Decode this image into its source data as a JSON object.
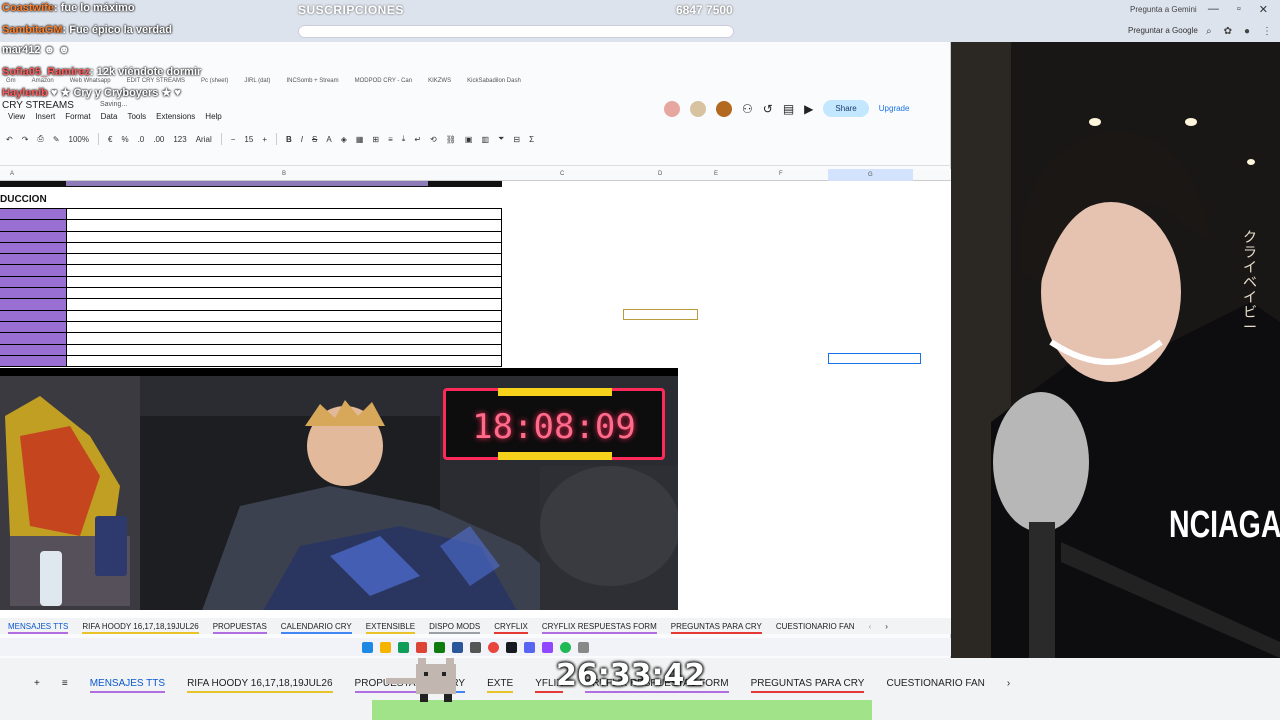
{
  "browser": {
    "tab_title": "SUSCRIPCIONES",
    "counts": "6847  7500",
    "gemini_label": "Pregunta a Gemini",
    "translate_label": "Preguntar a Google"
  },
  "chat": [
    {
      "user": "Coastwife",
      "msg": ": fue lo máximo"
    },
    {
      "user": "SambitaGM",
      "msg": ": Fue épico la verdad"
    },
    {
      "user": "",
      "msg": "mar412"
    },
    {
      "user": "Sofia05_Ramirez",
      "msg": ": 12k viéndote dormir"
    },
    {
      "user": "Haylenib",
      "msg": "Cry y Cryboyers"
    }
  ],
  "sheet": {
    "doc_title": "CRY STREAMS",
    "saving": "Saving...",
    "menus": [
      "View",
      "Insert",
      "Format",
      "Data",
      "Tools",
      "Extensions",
      "Help"
    ],
    "share_label": "Share",
    "upgrade_label": "Upgrade",
    "zoom": "100%",
    "font": "Arial",
    "font_size": "15",
    "currency": "€",
    "percent": "%",
    "dec_minus": ".0",
    "dec_plus": ".00",
    "num_format": "123",
    "columns": [
      "A",
      "B",
      "C",
      "D",
      "E",
      "F",
      "G"
    ],
    "section_label": "DUCCION",
    "bookmarks": [
      "Gm",
      "Amazon",
      "Web Whatsapp",
      "EDIT CRY STREAMS",
      "Pc (sheet)",
      "JIRL (dat)",
      "INCSomb + Stream",
      "MODPOD CRY - Can",
      "KIKZWS",
      "KickSabadilon Dash"
    ]
  },
  "video": {
    "timer": "18:08:09"
  },
  "tabs": [
    {
      "label": "MENSAJES TTS",
      "color": "#b06ee0",
      "active": true
    },
    {
      "label": "RIFA HOODY 16,17,18,19JUL26",
      "color": "#e8c32a",
      "active": false
    },
    {
      "label": "PROPUESTAS",
      "color": "#b06ee0",
      "active": false
    },
    {
      "label": "CALENDARIO CRY",
      "color": "#4285f4",
      "active": false
    },
    {
      "label": "EXTENSIBLE",
      "color": "#e8c32a",
      "active": false
    },
    {
      "label": "DISPO MODS",
      "color": "#9aa0a6",
      "active": false
    },
    {
      "label": "CRYFLIX",
      "color": "#e53935",
      "active": false
    },
    {
      "label": "CRYFLIX RESPUESTAS FORM",
      "color": "#b06ee0",
      "active": false
    },
    {
      "label": "PREGUNTAS PARA CRY",
      "color": "#e53935",
      "active": false
    },
    {
      "label": "CUESTIONARIO FAN",
      "color": "#f1f3f4",
      "active": false
    }
  ],
  "bottom_tabs": [
    {
      "label": "MENSAJES TTS",
      "color": "#b06ee0",
      "active": true
    },
    {
      "label": "RIFA HOODY 16,17,18,19JUL26",
      "color": "#e8c32a",
      "active": false
    },
    {
      "label": "PROPUESTAS",
      "color": "#b06ee0",
      "active": false
    },
    {
      "label": "CRY",
      "color": "#4285f4",
      "active": false
    },
    {
      "label": "EXTE",
      "color": "#e8c32a",
      "active": false
    },
    {
      "label": "YFLIX",
      "color": "#e53935",
      "active": false
    },
    {
      "label": "CRYFLIX RESPUESTAS FORM",
      "color": "#b06ee0",
      "active": false
    },
    {
      "label": "PREGUNTAS PARA CRY",
      "color": "#e53935",
      "active": false
    },
    {
      "label": "CUESTIONARIO FAN",
      "color": "#f1f3f4",
      "active": false
    }
  ],
  "overlay": {
    "big_timer": "26:33:42",
    "webcam_brand": "NCIAGA",
    "katakana": "クライベイビー"
  }
}
